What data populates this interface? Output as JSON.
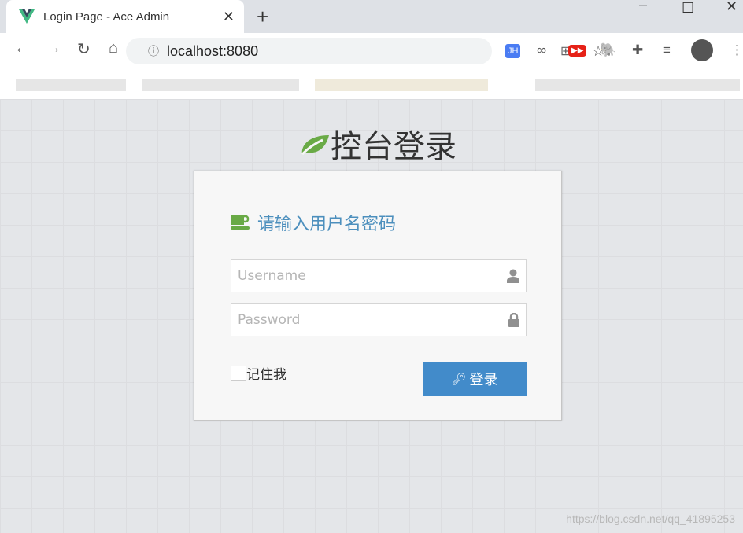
{
  "browser": {
    "tab_title": "Login Page - Ace Admin",
    "url": "localhost:8080",
    "new_tab": "+",
    "close": "✕"
  },
  "extensions": [
    "translate-icon",
    "star-icon",
    "jh-icon",
    "link-icon",
    "youtube-icon",
    "evernote-icon",
    "puzzle-icon",
    "media-icon",
    "profile-icon",
    "menu-icon"
  ],
  "brand": {
    "title": "控台登录",
    "icon": "leaf-icon",
    "icon_color": "#69aa46"
  },
  "login": {
    "header": "请输入用户名密码",
    "header_icon": "coffee-icon",
    "username_placeholder": "Username",
    "password_placeholder": "Password",
    "remember_label": "记住我",
    "submit_label": "登录",
    "accent": "#428bca"
  },
  "watermark": "https://blog.csdn.net/qq_41895253"
}
